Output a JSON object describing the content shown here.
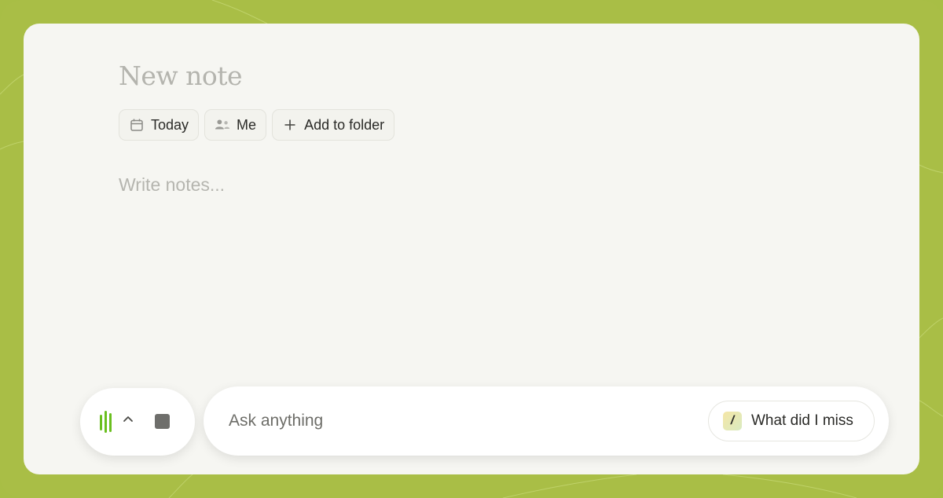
{
  "note": {
    "title_placeholder": "New note",
    "body_placeholder": "Write notes..."
  },
  "chips": [
    {
      "label": "Today",
      "icon": "calendar-icon"
    },
    {
      "label": "Me",
      "icon": "people-icon"
    },
    {
      "label": "Add to folder",
      "icon": "plus-icon"
    }
  ],
  "recorder": {
    "icons": [
      "audio-bars-icon",
      "chevron-up-icon",
      "stop-icon"
    ],
    "accent": "#6abf1f"
  },
  "ask": {
    "placeholder": "Ask anything",
    "shortcut_key": "/",
    "shortcut_label": "What did I miss"
  },
  "colors": {
    "frame": "#a9be46",
    "card": "#f6f6f2"
  }
}
